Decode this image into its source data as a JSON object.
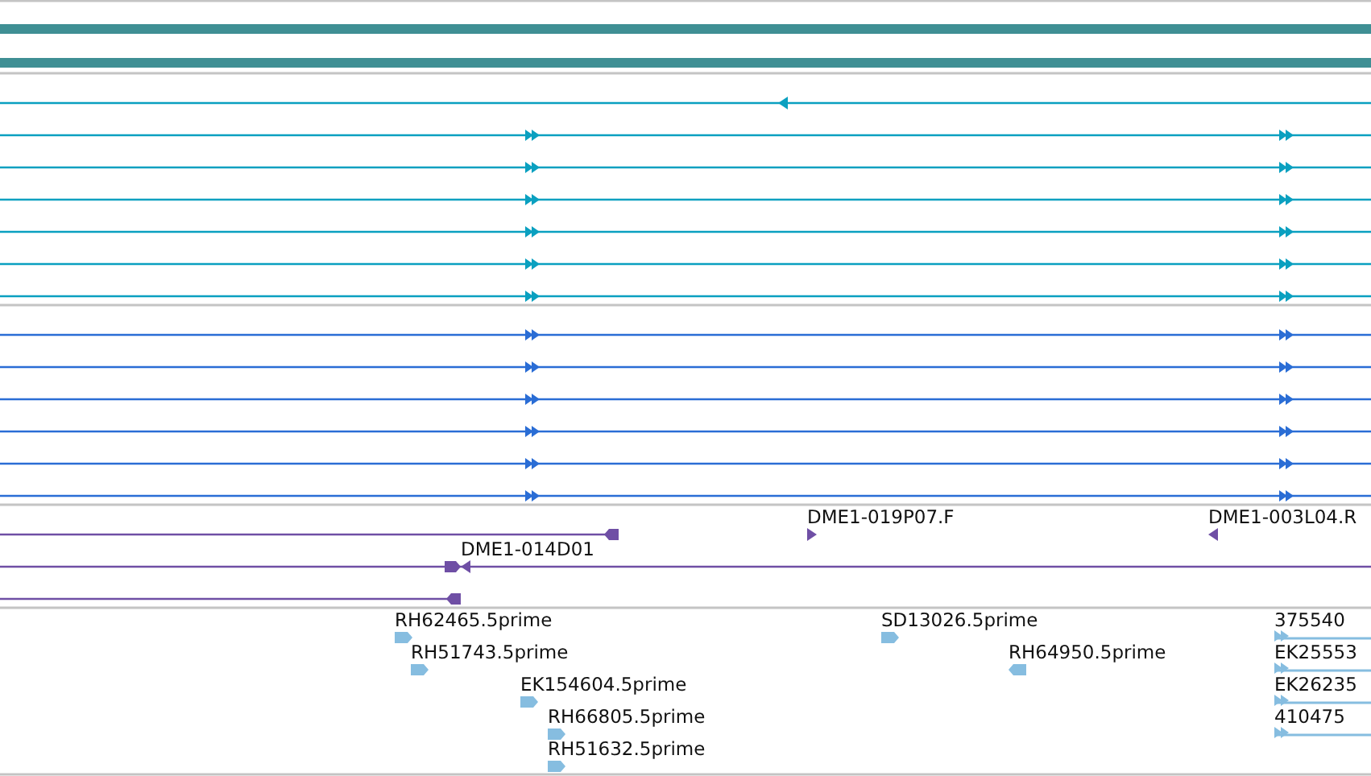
{
  "tracks": [
    {
      "features": [
        {
          "kind": "bar"
        },
        {
          "kind": "bar"
        }
      ]
    },
    {
      "features": [
        {
          "kind": "line",
          "reverse": true
        },
        {
          "kind": "line",
          "reverse": false
        },
        {
          "kind": "line",
          "reverse": false
        },
        {
          "kind": "line",
          "reverse": false
        },
        {
          "kind": "line",
          "reverse": false
        },
        {
          "kind": "line",
          "reverse": false
        },
        {
          "kind": "line",
          "reverse": false
        }
      ]
    },
    {
      "features": [
        {
          "kind": "line",
          "reverse": false
        },
        {
          "kind": "line",
          "reverse": false
        },
        {
          "kind": "line",
          "reverse": false
        },
        {
          "kind": "line",
          "reverse": false
        },
        {
          "kind": "line",
          "reverse": false
        },
        {
          "kind": "line",
          "reverse": false
        }
      ]
    },
    {
      "features": [
        {
          "kind": "line",
          "reverse": true
        },
        {
          "kind": "read",
          "reverse": false,
          "label": "DME1-019P07.F"
        },
        {
          "kind": "read",
          "reverse": true,
          "label": "DME1-003L04.R"
        },
        {
          "kind": "line",
          "reverse": true,
          "label": "DME1-014D01"
        },
        {
          "kind": "line",
          "reverse": true
        }
      ]
    },
    {
      "features": [
        {
          "kind": "read",
          "reverse": false,
          "label": "RH62465.5prime"
        },
        {
          "kind": "read",
          "reverse": false,
          "label": "RH51743.5prime"
        },
        {
          "kind": "read",
          "reverse": false,
          "label": "EK154604.5prime"
        },
        {
          "kind": "read",
          "reverse": false,
          "label": "RH66805.5prime"
        },
        {
          "kind": "read",
          "reverse": false,
          "label": "RH51632.5prime"
        },
        {
          "kind": "read",
          "reverse": false,
          "label": "SD13026.5prime"
        },
        {
          "kind": "read",
          "reverse": true,
          "label": "RH64950.5prime"
        },
        {
          "kind": "line",
          "reverse": false,
          "label": "375540"
        },
        {
          "kind": "line",
          "reverse": false,
          "label": "EK25553"
        },
        {
          "kind": "line",
          "reverse": false,
          "label": "EK26235"
        },
        {
          "kind": "line",
          "reverse": false,
          "label": "410475"
        }
      ]
    }
  ]
}
